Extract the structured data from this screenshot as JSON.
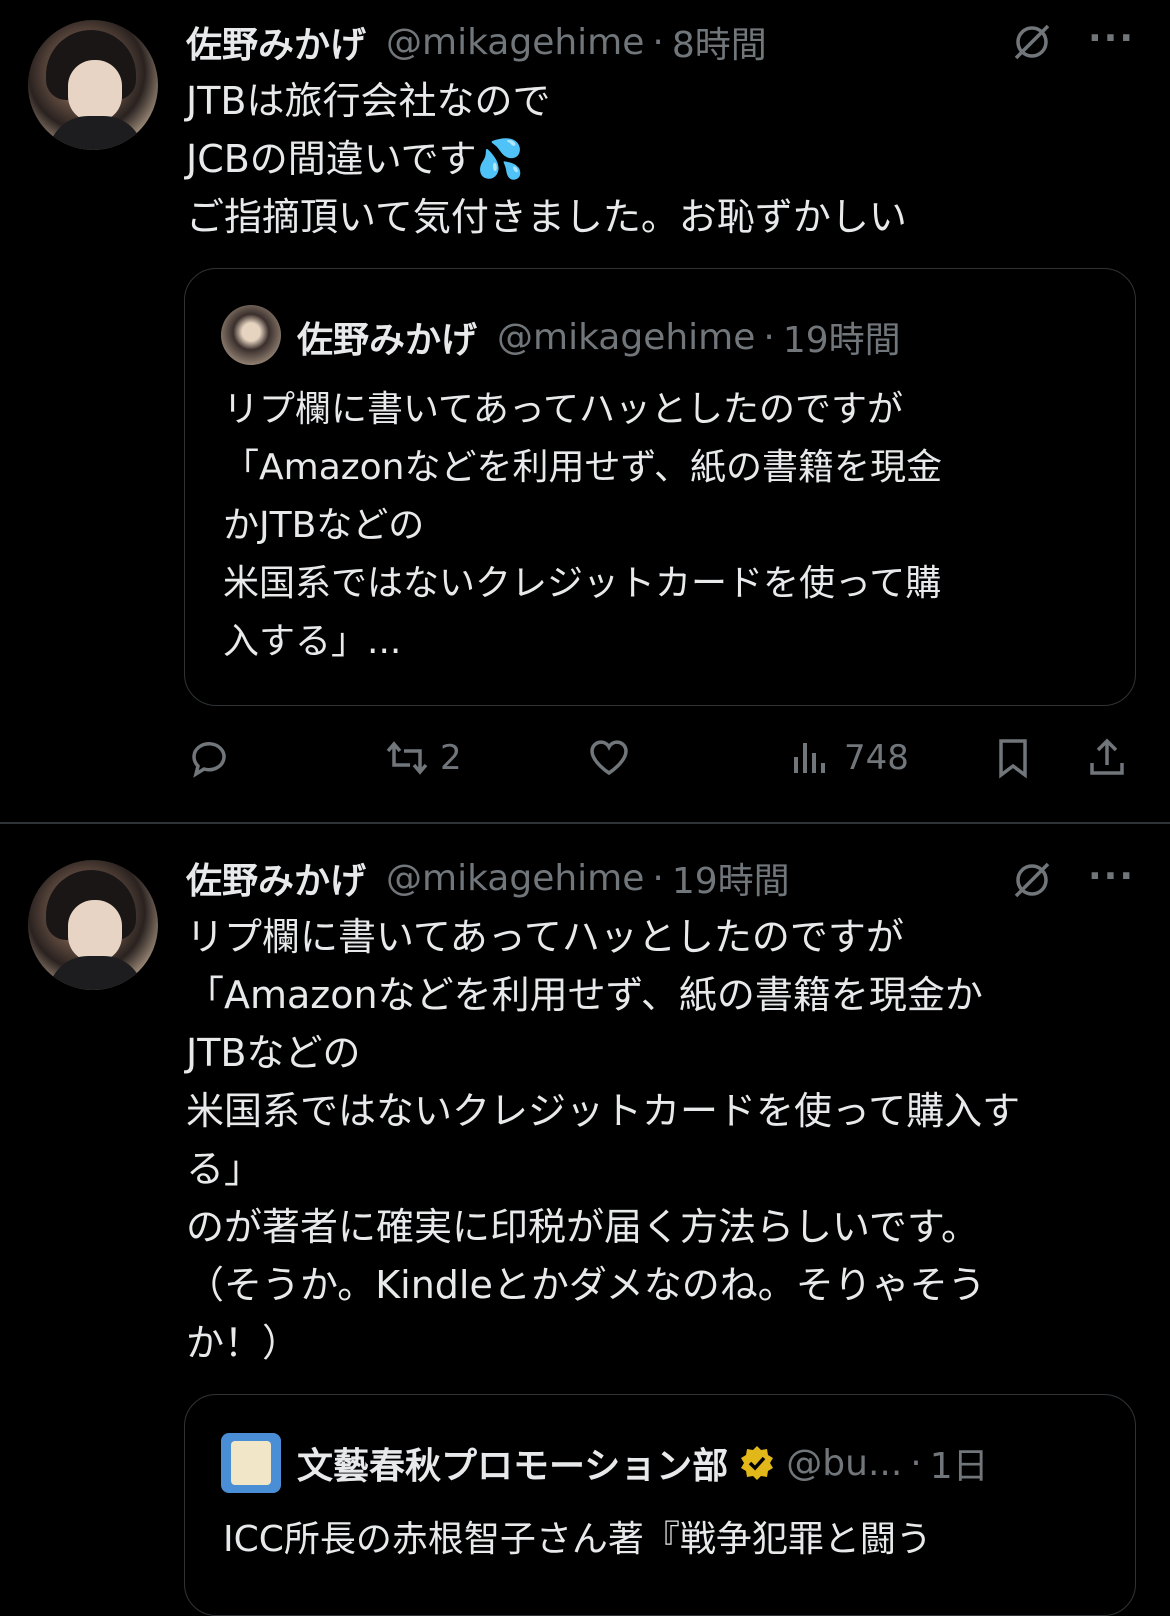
{
  "tweet1": {
    "name": "佐野みかげ",
    "handle": "@mikagehime",
    "time": "8時間",
    "text": "JTBは旅行会社なので\nJCBの間違いです💦\nご指摘頂いて気付きました。お恥ずかしい",
    "quote": {
      "name": "佐野みかげ",
      "handle": "@mikagehime",
      "time": "19時間",
      "text": "リプ欄に書いてあってハッとしたのですが\n「Amazonなどを利用せず、紙の書籍を現金\nかJTBなどの\n米国系ではないクレジットカードを使って購\n入する」..."
    },
    "retweets": "2",
    "views": "748"
  },
  "tweet2": {
    "name": "佐野みかげ",
    "handle": "@mikagehime",
    "time": "19時間",
    "text": "リプ欄に書いてあってハッとしたのですが\n「Amazonなどを利用せず、紙の書籍を現金か\nJTBなどの\n米国系ではないクレジットカードを使って購入す\nる」\nのが著者に確実に印税が届く方法らしいです。\n（そうか。Kindleとかダメなのね。そりゃそう\nか！）",
    "quote": {
      "name": "文藝春秋プロモーション部",
      "handle": "@bu...",
      "time": "1日",
      "text": "ICC所長の赤根智子さん著『戦争犯罪と闘う"
    }
  },
  "dot": "·",
  "more": "···",
  "icons": [
    "grok-icon",
    "more-icon",
    "reply-icon",
    "retweet-icon",
    "like-icon",
    "views-icon",
    "bookmark-icon",
    "share-icon",
    "verified-badge-icon"
  ],
  "colors": {
    "bg": "#000000",
    "text": "#e7e9ea",
    "muted": "#71767b",
    "border": "#2f3336",
    "gold": "#e2b719"
  }
}
